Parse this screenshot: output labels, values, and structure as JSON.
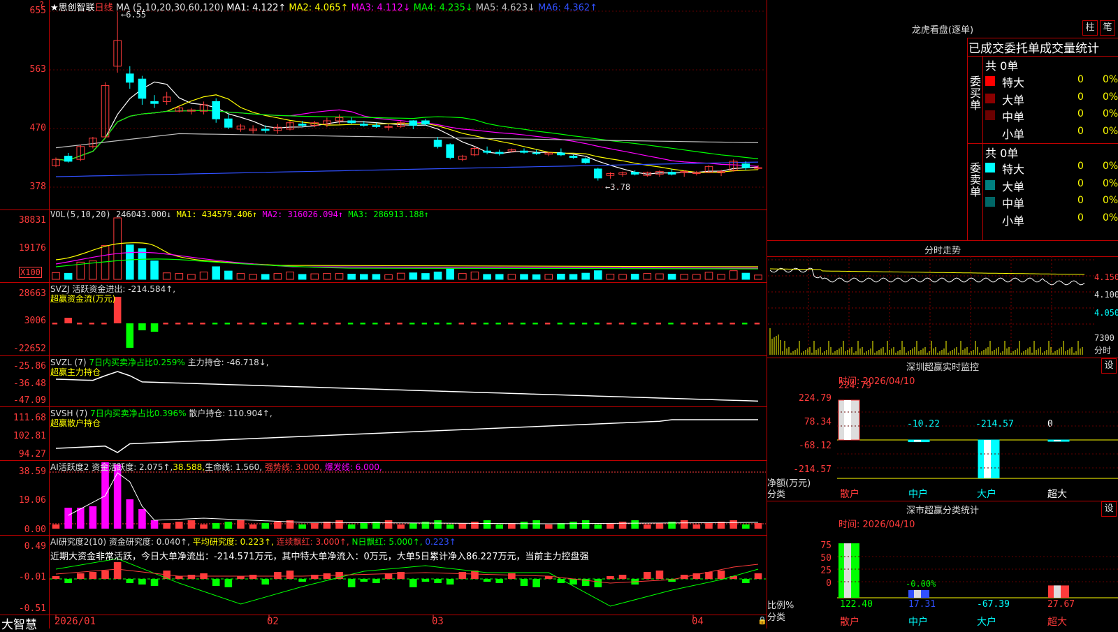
{
  "colors": {
    "up": "#ff3b3b",
    "down": "#00ffff",
    "grid": "#c00000",
    "ma1": "#ffffff",
    "ma2": "#ffff00",
    "ma3": "#ff00ff",
    "ma4": "#00ff00",
    "ma5": "#c0c0c0",
    "ma6": "#3050ff"
  },
  "price": {
    "stock_name": "★思创智联",
    "period": "日线",
    "ma_label": "MA (5,10,20,30,60,120)",
    "ma1": "MA1: 4.122↑",
    "ma2": "MA2: 4.065↑",
    "ma3": "MA3: 4.112↓",
    "ma4": "MA4: 4.235↓",
    "ma5": "MA5: 4.623↓",
    "ma6": "MA6: 4.362↑",
    "high_marker": "6.55",
    "low_marker": "3.78",
    "y_ticks": [
      "655",
      "563",
      "470",
      "378"
    ],
    "top_marker": "?"
  },
  "vol": {
    "label": "VOL(5,10,20)",
    "value": "246043.000↓",
    "ma1": "MA1: 434579.406↑",
    "ma2": "MA2: 316026.094↑",
    "ma3": "MA3: 286913.188↑",
    "y_ticks": [
      "38831",
      "19176"
    ],
    "unit": "X100"
  },
  "svzj": {
    "label": "SVZJ  活跃资金进出: -214.584↑,",
    "sub": "超赢资金流(万元)",
    "y_ticks": [
      "28663",
      "3006",
      "-22652"
    ]
  },
  "svzl": {
    "label": "SVZL (7) ",
    "l2": "7日内买卖净占比0.259%",
    "l3": " 主力持仓: -46.718↓,",
    "sub": "超赢主力持仓",
    "y_ticks": [
      "-25.86",
      "-36.48",
      "-47.09"
    ]
  },
  "svsh": {
    "label": "SVSH (7) ",
    "l2": "7日内买卖净占比0.396%",
    "l3": " 散户持仓: 110.904↑,",
    "sub": "超赢散户持仓",
    "y_ticks": [
      "111.68",
      "102.81",
      "94.27"
    ]
  },
  "ai1": {
    "label": "AI活跃度2 资金活跃度: 2.075↑,",
    "l2": "38.588,",
    "l3": "生命线: 1.560,",
    "l4": " 强势线: 3.000,",
    "l5": " 爆发线: 6.000,",
    "y_ticks": [
      "38.59",
      "19.06",
      "0.00"
    ]
  },
  "ai2": {
    "label": "AI研究度2(10) 资金研究度: 0.040↑,",
    "l2": " 平均研究度: 0.223↑,",
    "l3": " 连续飘红: 3.000↑,",
    "l4": " N日飘红: 5.000↑,",
    "l5": " 0.223↑",
    "comment": "近期大资金非常活跃，今日大单净流出：-214.571万元，其中特大单净流入：0万元，大单5日累计净入86.227万元，当前主力控盘强",
    "y_ticks": [
      "0.49",
      "-0.01",
      "-0.51"
    ]
  },
  "xaxis": {
    "brand": "大智慧",
    "labels": [
      "2026/01",
      "02",
      "03",
      "04"
    ]
  },
  "dragon": {
    "title": "龙虎看盘(逐单)",
    "btn1": "柱",
    "btn2": "笔",
    "subtitle": "已成交委托单成交量统计",
    "buy": {
      "side": "委买单",
      "total": "共 0单",
      "rows": [
        {
          "name": "特大",
          "qty": "0",
          "pct": "0%",
          "color": "#ff0000"
        },
        {
          "name": "大单",
          "qty": "0",
          "pct": "0%",
          "color": "#8b0000"
        },
        {
          "name": "中单",
          "qty": "0",
          "pct": "0%",
          "color": "#6b0000"
        },
        {
          "name": "小单",
          "qty": "0",
          "pct": "0%",
          "color": "#000000"
        }
      ]
    },
    "sell": {
      "side": "委卖单",
      "total": "共 0单",
      "rows": [
        {
          "name": "特大",
          "qty": "0",
          "pct": "0%",
          "color": "#00ffff"
        },
        {
          "name": "大单",
          "qty": "0",
          "pct": "0%",
          "color": "#008080"
        },
        {
          "name": "中单",
          "qty": "0",
          "pct": "0%",
          "color": "#006666"
        },
        {
          "name": "小单",
          "qty": "0",
          "pct": "0%",
          "color": "#000000"
        }
      ]
    }
  },
  "intraday": {
    "title": "分时走势",
    "y_ticks": [
      "4.150",
      "4.100",
      "4.050"
    ],
    "vol_tick": "7300",
    "unit": "分时"
  },
  "sz_monitor": {
    "title": "深圳超赢实时监控",
    "btn": "设",
    "time": "时间: 2026/04/10",
    "y_ticks": [
      "224.79",
      "78.34",
      "-68.12",
      "-214.57"
    ],
    "values": [
      "224.79",
      "-10.22",
      "-214.57",
      "0"
    ],
    "cats": [
      "散户",
      "中户",
      "大户",
      "超大"
    ],
    "ylabel": "净额(万元)",
    "xlabel": "分类"
  },
  "sz_class": {
    "title": "深市超赢分类统计",
    "btn": "设",
    "time": "时间: 2026/04/10",
    "y_ticks": [
      "75",
      "50",
      "25",
      "0"
    ],
    "values": [
      "122.40",
      "17.31",
      "-67.39",
      "27.67"
    ],
    "extra": "-0.00%",
    "cats": [
      "散户",
      "中户",
      "大户",
      "超大"
    ],
    "ylabel": "比例%",
    "xlabel": "分类"
  },
  "chart_data": [
    {
      "type": "candlestick",
      "title": "思创智联 日线",
      "ylim": [
        3.6,
        6.6
      ],
      "ohlc": [
        [
          4.15,
          4.28,
          4.13,
          4.25
        ],
        [
          4.3,
          4.35,
          4.2,
          4.22
        ],
        [
          4.25,
          4.48,
          4.22,
          4.45
        ],
        [
          4.45,
          4.6,
          4.42,
          4.58
        ],
        [
          4.6,
          5.45,
          4.58,
          5.4
        ],
        [
          5.7,
          6.55,
          5.6,
          6.1
        ],
        [
          5.58,
          5.7,
          5.35,
          5.45
        ],
        [
          5.5,
          5.55,
          5.1,
          5.2
        ],
        [
          5.15,
          5.25,
          5.05,
          5.12
        ],
        [
          5.15,
          5.3,
          5.1,
          5.22
        ],
        [
          5.0,
          5.08,
          4.98,
          5.05
        ],
        [
          5.0,
          5.05,
          4.95,
          5.02
        ],
        [
          5.0,
          5.15,
          4.95,
          5.1
        ],
        [
          5.15,
          5.2,
          4.82,
          4.88
        ],
        [
          4.88,
          4.95,
          4.72,
          4.75
        ],
        [
          4.72,
          4.8,
          4.68,
          4.77
        ],
        [
          4.7,
          4.78,
          4.65,
          4.72
        ],
        [
          4.72,
          4.78,
          4.66,
          4.7
        ],
        [
          4.7,
          4.8,
          4.65,
          4.75
        ],
        [
          4.72,
          4.85,
          4.7,
          4.82
        ],
        [
          4.8,
          4.85,
          4.75,
          4.78
        ],
        [
          4.78,
          4.85,
          4.75,
          4.82
        ],
        [
          4.8,
          4.9,
          4.75,
          4.85
        ],
        [
          4.85,
          4.95,
          4.8,
          4.9
        ],
        [
          4.85,
          4.9,
          4.8,
          4.82
        ],
        [
          4.8,
          4.85,
          4.76,
          4.78
        ],
        [
          4.78,
          4.82,
          4.74,
          4.76
        ],
        [
          4.75,
          4.8,
          4.7,
          4.76
        ],
        [
          4.76,
          4.85,
          4.74,
          4.82
        ],
        [
          4.85,
          4.86,
          4.72,
          4.78
        ],
        [
          4.85,
          4.88,
          4.78,
          4.8
        ],
        [
          4.55,
          4.6,
          4.42,
          4.45
        ],
        [
          4.48,
          4.5,
          4.25,
          4.28
        ],
        [
          4.25,
          4.32,
          4.22,
          4.3
        ],
        [
          4.32,
          4.45,
          4.3,
          4.42
        ],
        [
          4.38,
          4.45,
          4.33,
          4.36
        ],
        [
          4.36,
          4.4,
          4.31,
          4.34
        ],
        [
          4.38,
          4.42,
          4.36,
          4.4
        ],
        [
          4.38,
          4.42,
          4.34,
          4.36
        ],
        [
          4.35,
          4.4,
          4.32,
          4.34
        ],
        [
          4.33,
          4.36,
          4.3,
          4.35
        ],
        [
          4.35,
          4.42,
          4.3,
          4.32
        ],
        [
          4.3,
          4.32,
          4.26,
          4.28
        ],
        [
          4.26,
          4.28,
          4.18,
          4.2
        ],
        [
          4.1,
          4.12,
          3.92,
          3.96
        ],
        [
          4.0,
          4.05,
          3.95,
          4.03
        ],
        [
          4.02,
          4.06,
          3.98,
          4.04
        ],
        [
          4.05,
          4.08,
          4.0,
          4.02
        ],
        [
          4.0,
          4.06,
          3.98,
          4.05
        ],
        [
          4.02,
          4.08,
          3.98,
          4.06
        ],
        [
          4.05,
          4.1,
          4.0,
          4.02
        ],
        [
          4.04,
          4.08,
          3.98,
          4.06
        ],
        [
          4.03,
          4.07,
          4.0,
          4.05
        ],
        [
          4.05,
          4.16,
          4.04,
          4.14
        ],
        [
          4.04,
          4.09,
          3.99,
          4.06
        ],
        [
          4.08,
          4.25,
          4.06,
          4.22
        ],
        [
          4.18,
          4.22,
          4.08,
          4.12
        ],
        [
          4.12,
          4.16,
          4.09,
          4.12
        ]
      ]
    },
    {
      "type": "bar",
      "title": "VOL",
      "ylim": [
        0,
        38831
      ]
    },
    {
      "type": "bar",
      "title": "深圳超赢实时监控",
      "categories": [
        "散户",
        "中户",
        "大户",
        "超大"
      ],
      "values": [
        224.79,
        -10.22,
        -214.57,
        0
      ],
      "ylabel": "净额(万元)",
      "xlabel": "分类"
    },
    {
      "type": "bar",
      "title": "深市超赢分类统计",
      "categories": [
        "散户",
        "中户",
        "大户",
        "超大"
      ],
      "values": [
        122.4,
        17.31,
        -67.39,
        27.67
      ],
      "ylabel": "比例%",
      "xlabel": "分类"
    }
  ]
}
